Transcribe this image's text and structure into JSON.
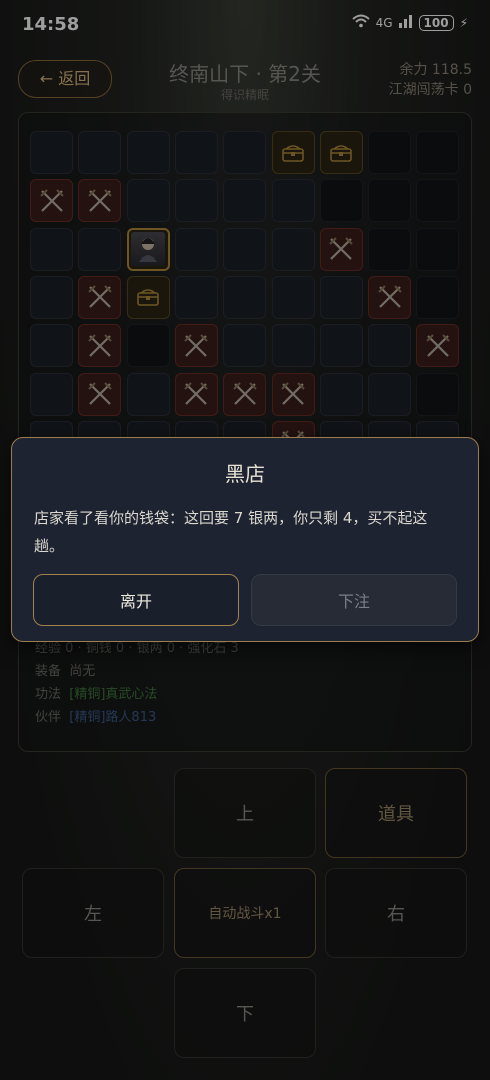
{
  "status_bar": {
    "time": "14:58",
    "network": "4G",
    "battery": "100"
  },
  "header": {
    "back_label": "← 返回",
    "title": "终南山下 · 第2关",
    "subtitle": "得识精眠",
    "stats": {
      "strength": "余力 118.5",
      "sweep_card": "江湖闯荡卡 0"
    }
  },
  "board": {
    "info": {
      "rewards": "经验 0 · 铜钱 0 · 银两 0 · 强化石 3",
      "equipment_label": "装备",
      "equipment_value": "尚无",
      "skill_label": "功法",
      "skill_value": "[精铜]真武心法",
      "partner_label": "伙伴",
      "partner_value": "[精铜]路人813"
    }
  },
  "controls": {
    "up": "上",
    "items": "道具",
    "left": "左",
    "auto_battle": "自动战斗x1",
    "right": "右",
    "down": "下"
  },
  "modal": {
    "title": "黑店",
    "message": "店家看了看你的钱袋：这回要 7 银两，你只剩 4，买不起这趟。",
    "leave_label": "离开",
    "bet_label": "下注"
  },
  "colors": {
    "accent_gold": "#a3824f",
    "enemy_red": "#6a2e26",
    "modal_bg": "#1d2330"
  }
}
